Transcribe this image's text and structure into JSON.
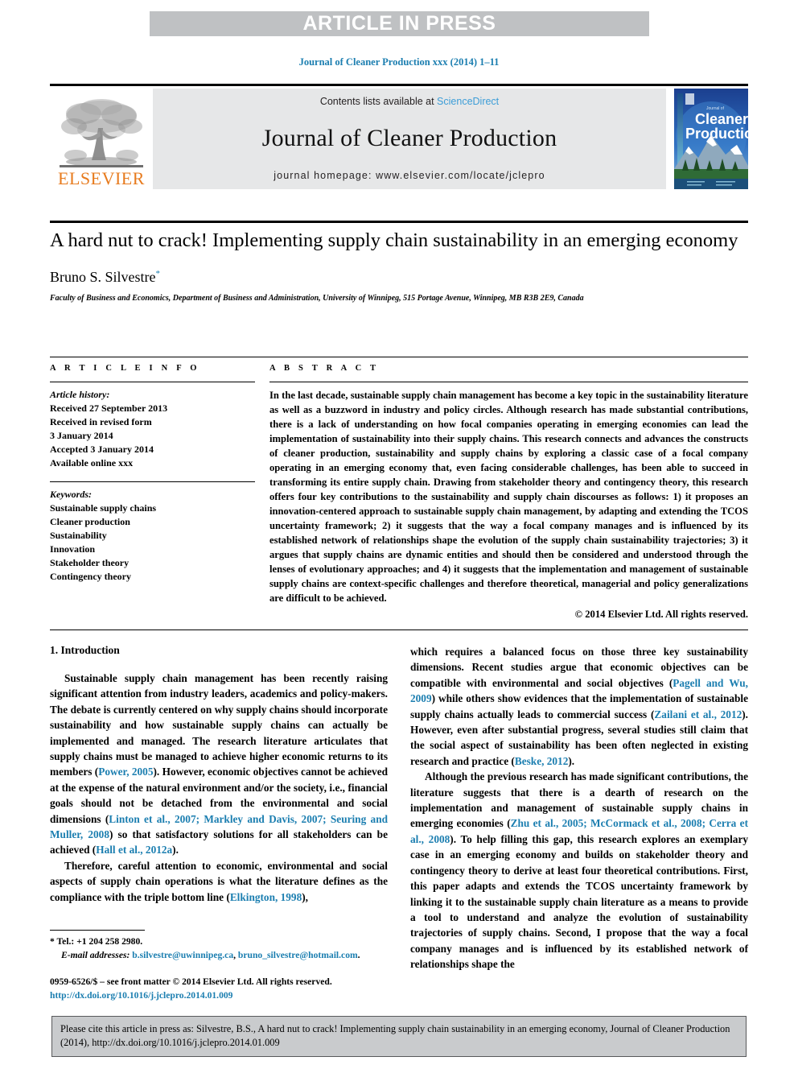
{
  "banner": {
    "label": "ARTICLE IN PRESS"
  },
  "running_head": "Journal of Cleaner Production xxx (2014) 1–11",
  "masthead": {
    "publisher": "ELSEVIER",
    "contents_prefix": "Contents lists available at ",
    "contents_link": "ScienceDirect",
    "journal_title": "Journal of Cleaner Production",
    "homepage": "journal homepage: www.elsevier.com/locate/jclepro",
    "cover_line1": "Journal of",
    "cover_line2": "Cleaner",
    "cover_line3": "Production"
  },
  "article": {
    "title": "A hard nut to crack! Implementing supply chain sustainability in an emerging economy",
    "author": "Bruno S. Silvestre",
    "author_marker": "*",
    "affiliation": "Faculty of Business and Economics, Department of Business and Administration, University of Winnipeg, 515 Portage Avenue, Winnipeg, MB R3B 2E9, Canada"
  },
  "info": {
    "header": "A R T I C L E   I N F O",
    "history_label": "Article history:",
    "history": [
      "Received 27 September 2013",
      "Received in revised form",
      "3 January 2014",
      "Accepted 3 January 2014",
      "Available online xxx"
    ],
    "keywords_label": "Keywords:",
    "keywords": [
      "Sustainable supply chains",
      "Cleaner production",
      "Sustainability",
      "Innovation",
      "Stakeholder theory",
      "Contingency theory"
    ]
  },
  "abstract": {
    "header": "A B S T R A C T",
    "text": "In the last decade, sustainable supply chain management has become a key topic in the sustainability literature as well as a buzzword in industry and policy circles. Although research has made substantial contributions, there is a lack of understanding on how focal companies operating in emerging economies can lead the implementation of sustainability into their supply chains. This research connects and advances the constructs of cleaner production, sustainability and supply chains by exploring a classic case of a focal company operating in an emerging economy that, even facing considerable challenges, has been able to succeed in transforming its entire supply chain. Drawing from stakeholder theory and contingency theory, this research offers four key contributions to the sustainability and supply chain discourses as follows: 1) it proposes an innovation-centered approach to sustainable supply chain management, by adapting and extending the TCOS uncertainty framework; 2) it suggests that the way a focal company manages and is influenced by its established network of relationships shape the evolution of the supply chain sustainability trajectories; 3) it argues that supply chains are dynamic entities and should then be considered and understood through the lenses of evolutionary approaches; and 4) it suggests that the implementation and management of sustainable supply chains are context-specific challenges and therefore theoretical, managerial and policy generalizations are difficult to be achieved.",
    "copyright": "© 2014 Elsevier Ltd. All rights reserved."
  },
  "body": {
    "section_heading": "1. Introduction",
    "left_paragraphs": [
      {
        "parts": [
          {
            "t": "Sustainable supply chain management has been recently raising significant attention from industry leaders, academics and policy-makers. The debate is currently centered on why supply chains should incorporate sustainability and how sustainable supply chains can actually be implemented and managed. The research literature articulates that supply chains must be managed to achieve higher economic returns to its members (",
            "cite": false
          },
          {
            "t": "Power, 2005",
            "cite": true
          },
          {
            "t": "). However, economic objectives cannot be achieved at the expense of the natural environment and/or the society, i.e., financial goals should not be detached from the environmental and social dimensions (",
            "cite": false
          },
          {
            "t": "Linton et al., 2007; Markley and Davis, 2007; Seuring and Muller, 2008",
            "cite": true
          },
          {
            "t": ") so that satisfactory solutions for all stakeholders can be achieved (",
            "cite": false
          },
          {
            "t": "Hall et al., 2012a",
            "cite": true
          },
          {
            "t": ").",
            "cite": false
          }
        ]
      },
      {
        "parts": [
          {
            "t": "Therefore, careful attention to economic, environmental and social aspects of supply chain operations is what the literature defines as the compliance with the triple bottom line (",
            "cite": false
          },
          {
            "t": "Elkington, 1998",
            "cite": true
          },
          {
            "t": "),",
            "cite": false
          }
        ]
      }
    ],
    "right_paragraphs": [
      {
        "continuation": true,
        "parts": [
          {
            "t": "which requires a balanced focus on those three key sustainability dimensions. Recent studies argue that economic objectives can be compatible with environmental and social objectives (",
            "cite": false
          },
          {
            "t": "Pagell and Wu, 2009",
            "cite": true
          },
          {
            "t": ") while others show evidences that the implementation of sustainable supply chains actually leads to commercial success (",
            "cite": false
          },
          {
            "t": "Zailani et al., 2012",
            "cite": true
          },
          {
            "t": "). However, even after substantial progress, several studies still claim that the social aspect of sustainability has been often neglected in existing research and practice (",
            "cite": false
          },
          {
            "t": "Beske, 2012",
            "cite": true
          },
          {
            "t": ").",
            "cite": false
          }
        ]
      },
      {
        "continuation": false,
        "parts": [
          {
            "t": "Although the previous research has made significant contributions, the literature suggests that there is a dearth of research on the implementation and management of sustainable supply chains in emerging economies (",
            "cite": false
          },
          {
            "t": "Zhu et al., 2005; McCormack et al., 2008; Cerra et al., 2008",
            "cite": true
          },
          {
            "t": "). To help filling this gap, this research explores an exemplary case in an emerging economy and builds on stakeholder theory and contingency theory to derive at least four theoretical contributions. First, this paper adapts and extends the TCOS uncertainty framework by linking it to the sustainable supply chain literature as a means to provide a tool to understand and analyze the evolution of sustainability trajectories of supply chains. Second, I propose that the way a focal company manages and is influenced by its established network of relationships shape the",
            "cite": false
          }
        ]
      }
    ]
  },
  "footnote": {
    "tel_marker": "*",
    "tel": "Tel.: +1 204 258 2980.",
    "email_label": "E-mail addresses:",
    "email1": "b.silvestre@uwinnipeg.ca",
    "email_sep": ", ",
    "email2": "bruno_silvestre@hotmail.com",
    "email_end": "."
  },
  "issn": {
    "line": "0959-6526/$ – see front matter © 2014 Elsevier Ltd. All rights reserved.",
    "doi": "http://dx.doi.org/10.1016/j.jclepro.2014.01.009"
  },
  "cite_box": {
    "text": "Please cite this article in press as: Silvestre, B.S., A hard nut to crack! Implementing supply chain sustainability in an emerging economy, Journal of Cleaner Production (2014), http://dx.doi.org/10.1016/j.jclepro.2014.01.009"
  },
  "colors": {
    "link_blue": "#1b7eb0",
    "sciencedirect_blue": "#3c9dd7",
    "elsevier_orange": "#e77b1e",
    "banner_grey": "#bfc1c3",
    "band_grey": "#e6e7e8",
    "cite_box_grey": "#c9cbcd"
  }
}
